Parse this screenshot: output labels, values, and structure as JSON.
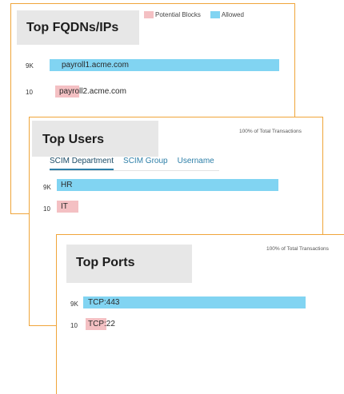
{
  "colors": {
    "allowed": "#81d4f2",
    "potential_blocks": "#f4c0c3",
    "card_border": "#f0a53a",
    "title_bg": "#e7e7e7"
  },
  "fqdn": {
    "title": "Top FQDNs/IPs",
    "legend": {
      "potential_blocks": "Potential Blocks",
      "allowed": "Allowed"
    },
    "rows": [
      {
        "count": "9K",
        "label": "payroll1.acme.com",
        "type": "allowed"
      },
      {
        "count": "10",
        "label": "payroll2.acme.com",
        "type": "potential_blocks"
      }
    ]
  },
  "users": {
    "title": "Top Users",
    "percent_note": "100% of Total Transactions",
    "tabs": [
      {
        "label": "SCIM Department",
        "active": true
      },
      {
        "label": "SCIM Group",
        "active": false
      },
      {
        "label": "Username",
        "active": false
      }
    ],
    "rows": [
      {
        "count": "9K",
        "label": "HR",
        "type": "allowed"
      },
      {
        "count": "10",
        "label": "IT",
        "type": "potential_blocks"
      }
    ]
  },
  "ports": {
    "title": "Top Ports",
    "percent_note": "100% of Total Transactions",
    "rows": [
      {
        "count": "9K",
        "label": "TCP:443",
        "type": "allowed"
      },
      {
        "count": "10",
        "label": "TCP:22",
        "type": "potential_blocks"
      }
    ]
  }
}
